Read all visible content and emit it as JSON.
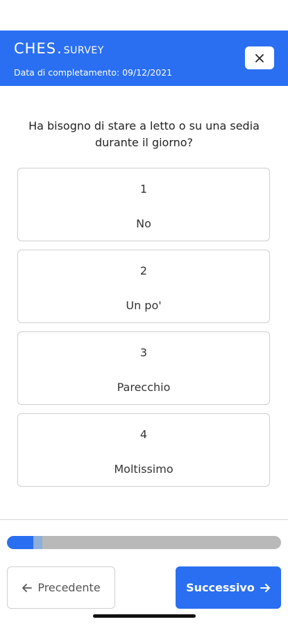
{
  "header": {
    "logo_main": "CHES",
    "logo_dot": ".",
    "logo_sub": "SURVEY",
    "completion_text": "Data di completamento: 09/12/2021",
    "close_icon": "close-icon",
    "color": "#2a6ff1"
  },
  "question": {
    "text": "Ha bisogno di stare a letto o su una sedia durante il giorno?"
  },
  "options": [
    {
      "number": "1",
      "label": "No"
    },
    {
      "number": "2",
      "label": "Un po'"
    },
    {
      "number": "3",
      "label": "Parecchio"
    },
    {
      "number": "4",
      "label": "Moltissimo"
    }
  ],
  "progress": {
    "fraction": 0.13
  },
  "navigation": {
    "prev_label": "Precedente",
    "prev_icon": "arrow-left-icon",
    "next_label": "Successivo",
    "next_icon": "arrow-right-icon"
  }
}
